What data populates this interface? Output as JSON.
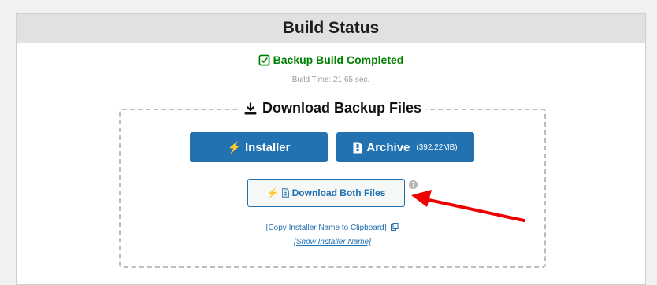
{
  "header": {
    "title": "Build Status"
  },
  "status": {
    "message": "Backup Build Completed",
    "build_time": "Build Time: 21.65 sec."
  },
  "download": {
    "legend": "Download Backup Files",
    "installer_label": "Installer",
    "archive_label": "Archive",
    "archive_size": "(392.22MB)",
    "both_label": "Download Both Files",
    "help_glyph": "?",
    "copy_link": "[Copy Installer Name to Clipboard]",
    "show_link": "[Show Installer Name]"
  },
  "icons": {
    "check": "check-square-icon",
    "download": "download-icon",
    "bolt": "bolt-icon",
    "archive": "file-archive-icon",
    "copy": "copy-icon",
    "help": "question-circle-icon",
    "annotation": "red-arrow"
  },
  "colors": {
    "accent": "#2271b1",
    "success": "#008000",
    "annotation": "#ee0000"
  }
}
